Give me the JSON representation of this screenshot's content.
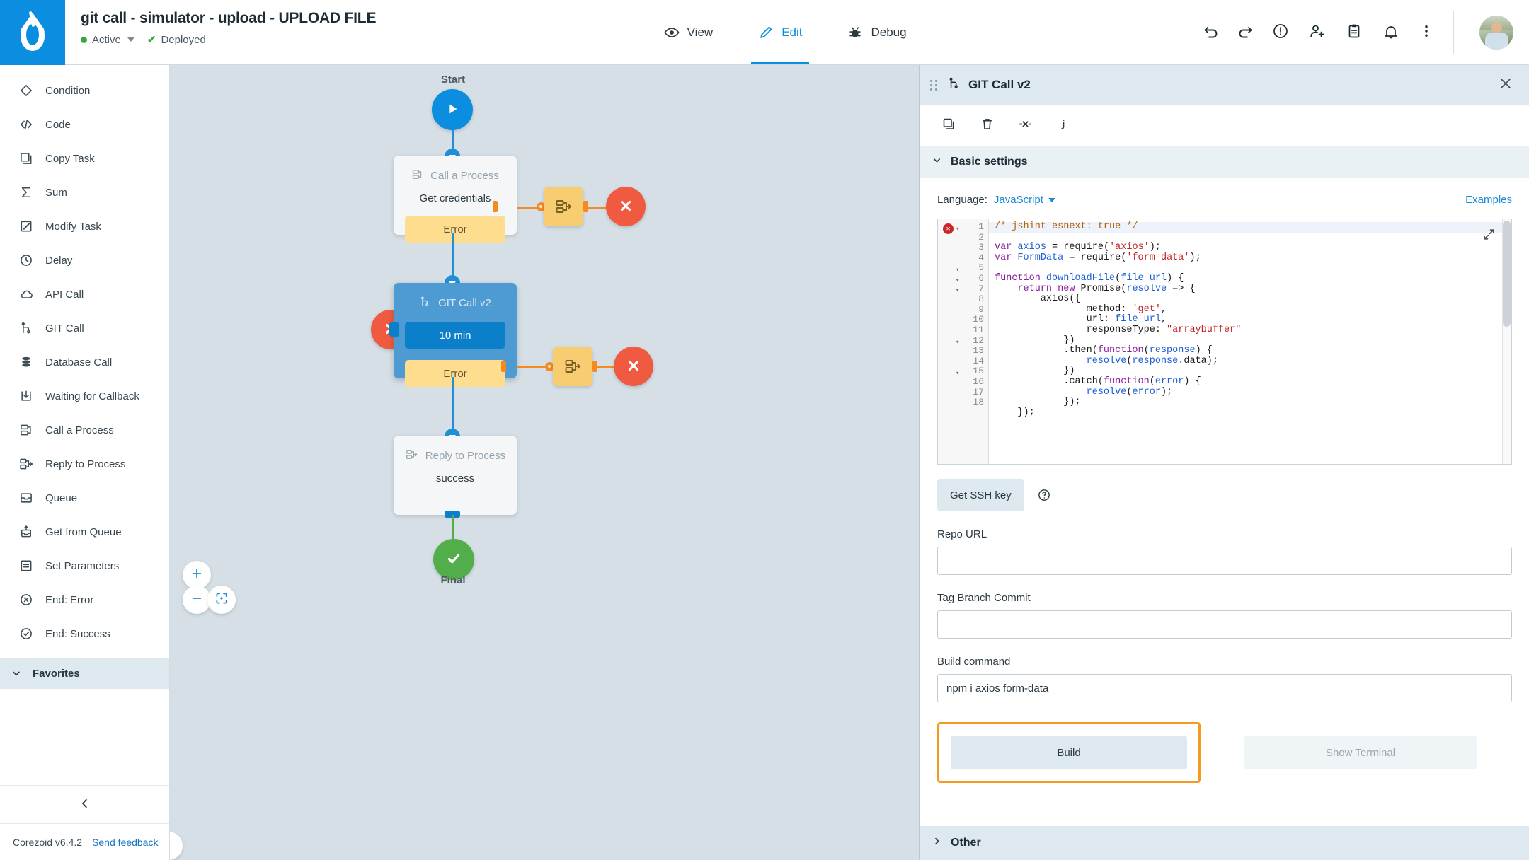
{
  "header": {
    "app_title": "git call - simulator - upload - UPLOAD FILE",
    "status_active": "Active",
    "status_deployed": "Deployed",
    "tabs": [
      {
        "label": "View",
        "icon": "eye-icon",
        "active": false
      },
      {
        "label": "Edit",
        "icon": "pencil-icon",
        "active": true
      },
      {
        "label": "Debug",
        "icon": "bug-icon",
        "active": false
      }
    ],
    "actions": [
      "undo-icon",
      "redo-icon",
      "alert-circle-icon",
      "add-user-icon",
      "clipboard-icon",
      "bell-icon",
      "more-vertical-icon"
    ]
  },
  "sidebar": {
    "items": [
      {
        "label": "Condition",
        "icon": "diamond-icon"
      },
      {
        "label": "Code",
        "icon": "code-brackets-icon"
      },
      {
        "label": "Copy Task",
        "icon": "copy-icon"
      },
      {
        "label": "Sum",
        "icon": "sigma-icon"
      },
      {
        "label": "Modify Task",
        "icon": "edit-square-icon"
      },
      {
        "label": "Delay",
        "icon": "clock-icon"
      },
      {
        "label": "API Call",
        "icon": "cloud-icon"
      },
      {
        "label": "GIT Call",
        "icon": "git-branch-icon"
      },
      {
        "label": "Database Call",
        "icon": "database-icon"
      },
      {
        "label": "Waiting for Callback",
        "icon": "download-box-icon"
      },
      {
        "label": "Call a Process",
        "icon": "process-icon"
      },
      {
        "label": "Reply to Process",
        "icon": "process-arrow-icon"
      },
      {
        "label": "Queue",
        "icon": "inbox-icon"
      },
      {
        "label": "Get from Queue",
        "icon": "inbox-up-icon"
      },
      {
        "label": "Set Parameters",
        "icon": "list-box-icon"
      },
      {
        "label": "End: Error",
        "icon": "x-circle-icon"
      },
      {
        "label": "End: Success",
        "icon": "check-circle-icon"
      }
    ],
    "favorites_label": "Favorites",
    "collapse_icon": "chevron-left-icon",
    "version": "Corezoid v6.4.2",
    "feedback_link": "Send feedback"
  },
  "canvas": {
    "start_label": "Start",
    "final_label": "Final",
    "nodes": [
      {
        "id": "call-process",
        "type": "Call a Process",
        "name": "Get credentials",
        "chip": "Error"
      },
      {
        "id": "git-call",
        "type": "GIT Call v2",
        "name": "",
        "chip_time": "10 min",
        "chip_error": "Error"
      },
      {
        "id": "reply",
        "type": "Reply to Process",
        "name": "success",
        "chip": ""
      }
    ],
    "zoom_controls": [
      "zoom-in-icon",
      "zoom-out-icon",
      "fit-to-screen-icon"
    ]
  },
  "panel": {
    "title": "GIT Call v2",
    "title_icon": "git-branch-icon",
    "close_icon": "close-icon",
    "toolbar": [
      "copy-icon",
      "trash-icon",
      "split-icon",
      "info-icon"
    ],
    "basic_settings_label": "Basic settings",
    "other_label": "Other",
    "language_label": "Language:",
    "language_value": "JavaScript",
    "examples_label": "Examples",
    "code_lines": [
      "/* jshint esnext: true */",
      "var axios = require('axios');",
      "var FormData = require('form-data');",
      "",
      "function downloadFile(file_url) {",
      "    return new Promise(resolve => {",
      "        axios({",
      "                method: 'get',",
      "                url: file_url,",
      "                responseType: \"arraybuffer\"",
      "            })",
      "            .then(function(response) {",
      "                resolve(response.data);",
      "            })",
      "            .catch(function(error) {",
      "                resolve(error);",
      "            });",
      "    });"
    ],
    "line_numbers": [
      1,
      2,
      3,
      4,
      5,
      6,
      7,
      8,
      9,
      10,
      11,
      12,
      13,
      14,
      15,
      16,
      17,
      18
    ],
    "expand_icon": "expand-icon",
    "ssh_button": "Get SSH key",
    "help_icon": "question-circle-icon",
    "fields": [
      {
        "label": "Repo URL",
        "value": "",
        "placeholder": ""
      },
      {
        "label": "Tag Branch Commit",
        "value": "",
        "placeholder": ""
      },
      {
        "label": "Build command",
        "value": "npm i axios form-data",
        "placeholder": ""
      }
    ],
    "build_button": "Build",
    "terminal_button": "Show Terminal",
    "highlight_color": "#f59a1e"
  },
  "colors": {
    "brand_blue": "#0b8ee0",
    "error_red": "#ef5a40",
    "success_green": "#52ae4b",
    "warn_yellow": "#f8cd72",
    "orange_edge": "#f58b1f",
    "canvas_bg": "#d5dfe5",
    "panel_head_bg": "#dde8ef"
  }
}
